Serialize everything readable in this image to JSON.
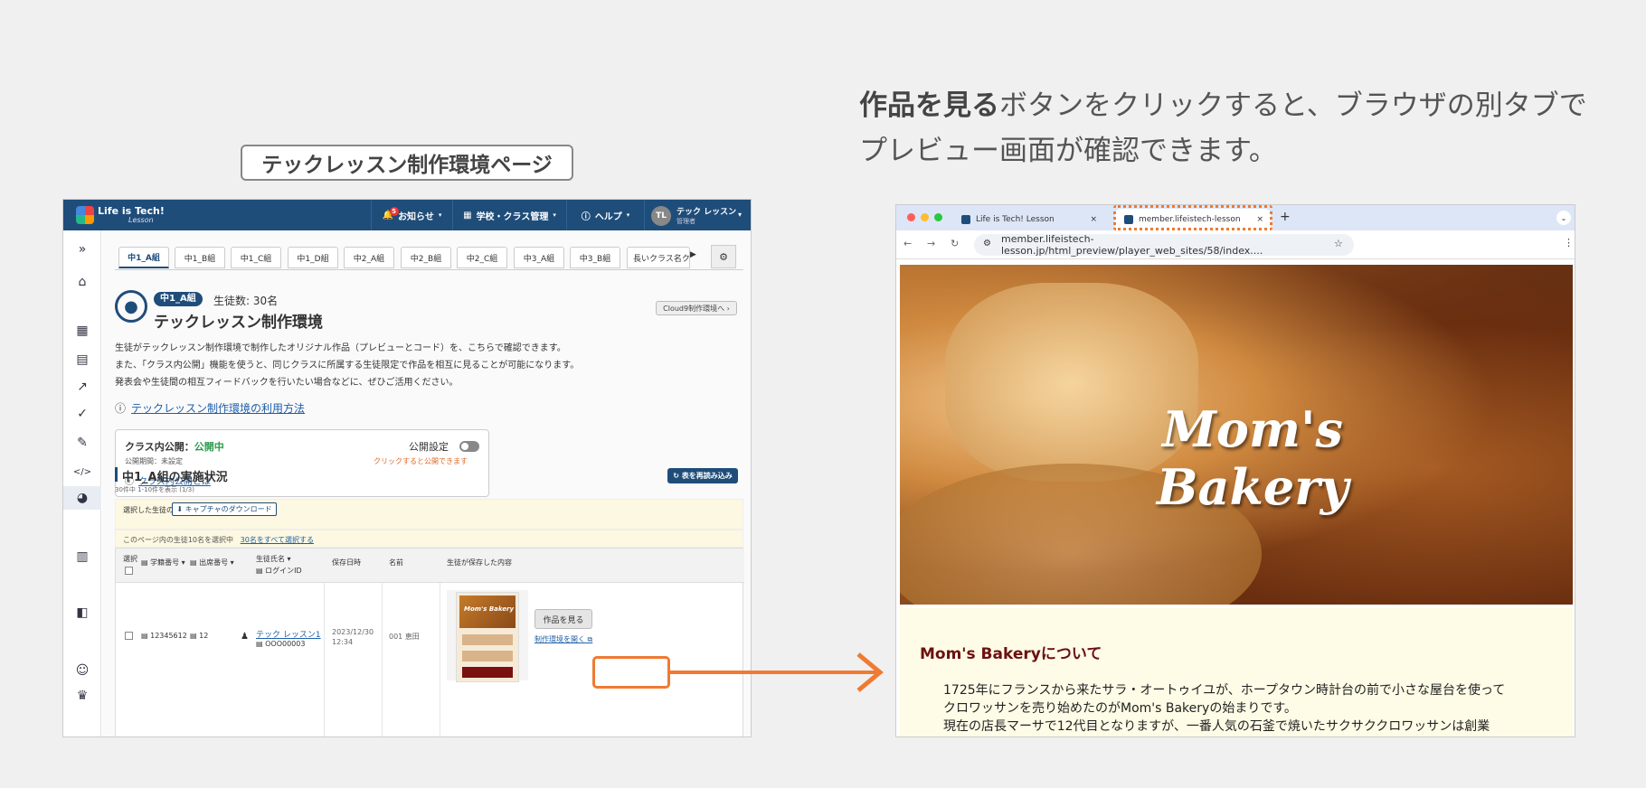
{
  "caption": {
    "bold": "作品を見る",
    "rest": "ボタンをクリックすると、ブラウザの別タブでプレビュー画面が確認できます。"
  },
  "page_label": "テックレッスン制作環境ページ",
  "app": {
    "brand": "Life is Tech!",
    "brand_sub": "Lesson",
    "nav": {
      "notice": "お知らせ",
      "notice_badge": "5",
      "school": "学校・クラス管理",
      "help": "ヘルプ",
      "user_initials": "TL",
      "user_name": "テック レッスン",
      "user_role": "管理者"
    },
    "sidebar_icons": [
      "expand-icon",
      "home-icon",
      "calendar-icon",
      "document-check-icon",
      "trend-icon",
      "check-circle-icon",
      "pencil-icon",
      "code-icon",
      "palette-icon",
      "chart-icon",
      "book-icon",
      "smile-icon",
      "trophy-icon"
    ],
    "tabs": [
      "中1_A組",
      "中1_B組",
      "中1_C組",
      "中1_D組",
      "中2_A組",
      "中2_B組",
      "中2_C組",
      "中3_A組",
      "中3_B組",
      "長いクラス名ク"
    ],
    "class_pill": "中1_A組",
    "student_count": "生徒数: 30名",
    "title": "テックレッスン制作環境",
    "cloud9_button": "Cloud9制作環境へ",
    "description": [
      "生徒がテックレッスン制作環境で制作したオリジナル作品（プレビューとコード）を、こちらで確認できます。",
      "また、「クラス内公開」機能を使うと、同じクラスに所属する生徒限定で作品を相互に見ることが可能になります。",
      "発表会や生徒間の相互フィードバックを行いたい場合などに、ぜひご活用ください。"
    ],
    "howto_link": "テックレッスン制作環境の利用方法",
    "publish": {
      "label": "クラス内公開：",
      "status": "公開中",
      "period": "公開期間：未設定",
      "settings_label": "公開設定",
      "hint": "クリックすると公開できます",
      "what_link": "クラス内公開とは"
    },
    "section_title": "中1_A組の実施状況",
    "section_count": "30件中 1-10件を表示 (1/3)",
    "reload_button": "表を再読み込み",
    "selected_label": "選択した生徒の",
    "capture_button": "キャプチャのダウンロード",
    "select_page": "このページ内の生徒10名を選択中",
    "select_all_link": "30名をすべて選択する",
    "headers": {
      "select": "選択",
      "student_no": "学籍番号",
      "seat_no": "出席番号",
      "student_name": "生徒氏名",
      "login_id": "ログインID",
      "saved_at": "保存日時",
      "name": "名前",
      "saved_content": "生徒が保存した内容"
    },
    "row": {
      "student_no": "12345612",
      "seat_no": "12",
      "student_name": "テック レッスン1",
      "login_id": "OOO00003",
      "saved_date": "2023/12/30",
      "saved_time": "12:34",
      "name": "001 恵田",
      "thumb_title": "Mom's Bakery",
      "view_button": "作品を見る",
      "open_env_link": "制作環境を開く"
    }
  },
  "browser": {
    "tab1": "Life is Tech! Lesson",
    "tab2": "member.lifeistech-lesson.jp",
    "url": "member.lifeistech-lesson.jp/html_preview/player_web_sites/58/index....",
    "hero_title": "Mom's Bakery",
    "about_heading": "Mom's Bakeryについて",
    "para1": "1725年にフランスから来たサラ・オートゥイユが、ホープタウン時計台の前で小さな屋台を使って",
    "para2": "クロワッサンを売り始めたのがMom's Bakeryの始まりです。",
    "para3": "現在の店長マーサで12代目となりますが、一番人気の石釜で焼いたサクサククロワッサンは創業"
  },
  "colors": {
    "navy": "#1f4d7a",
    "highlight": "#f07a32",
    "heading_red": "#6b1010"
  }
}
